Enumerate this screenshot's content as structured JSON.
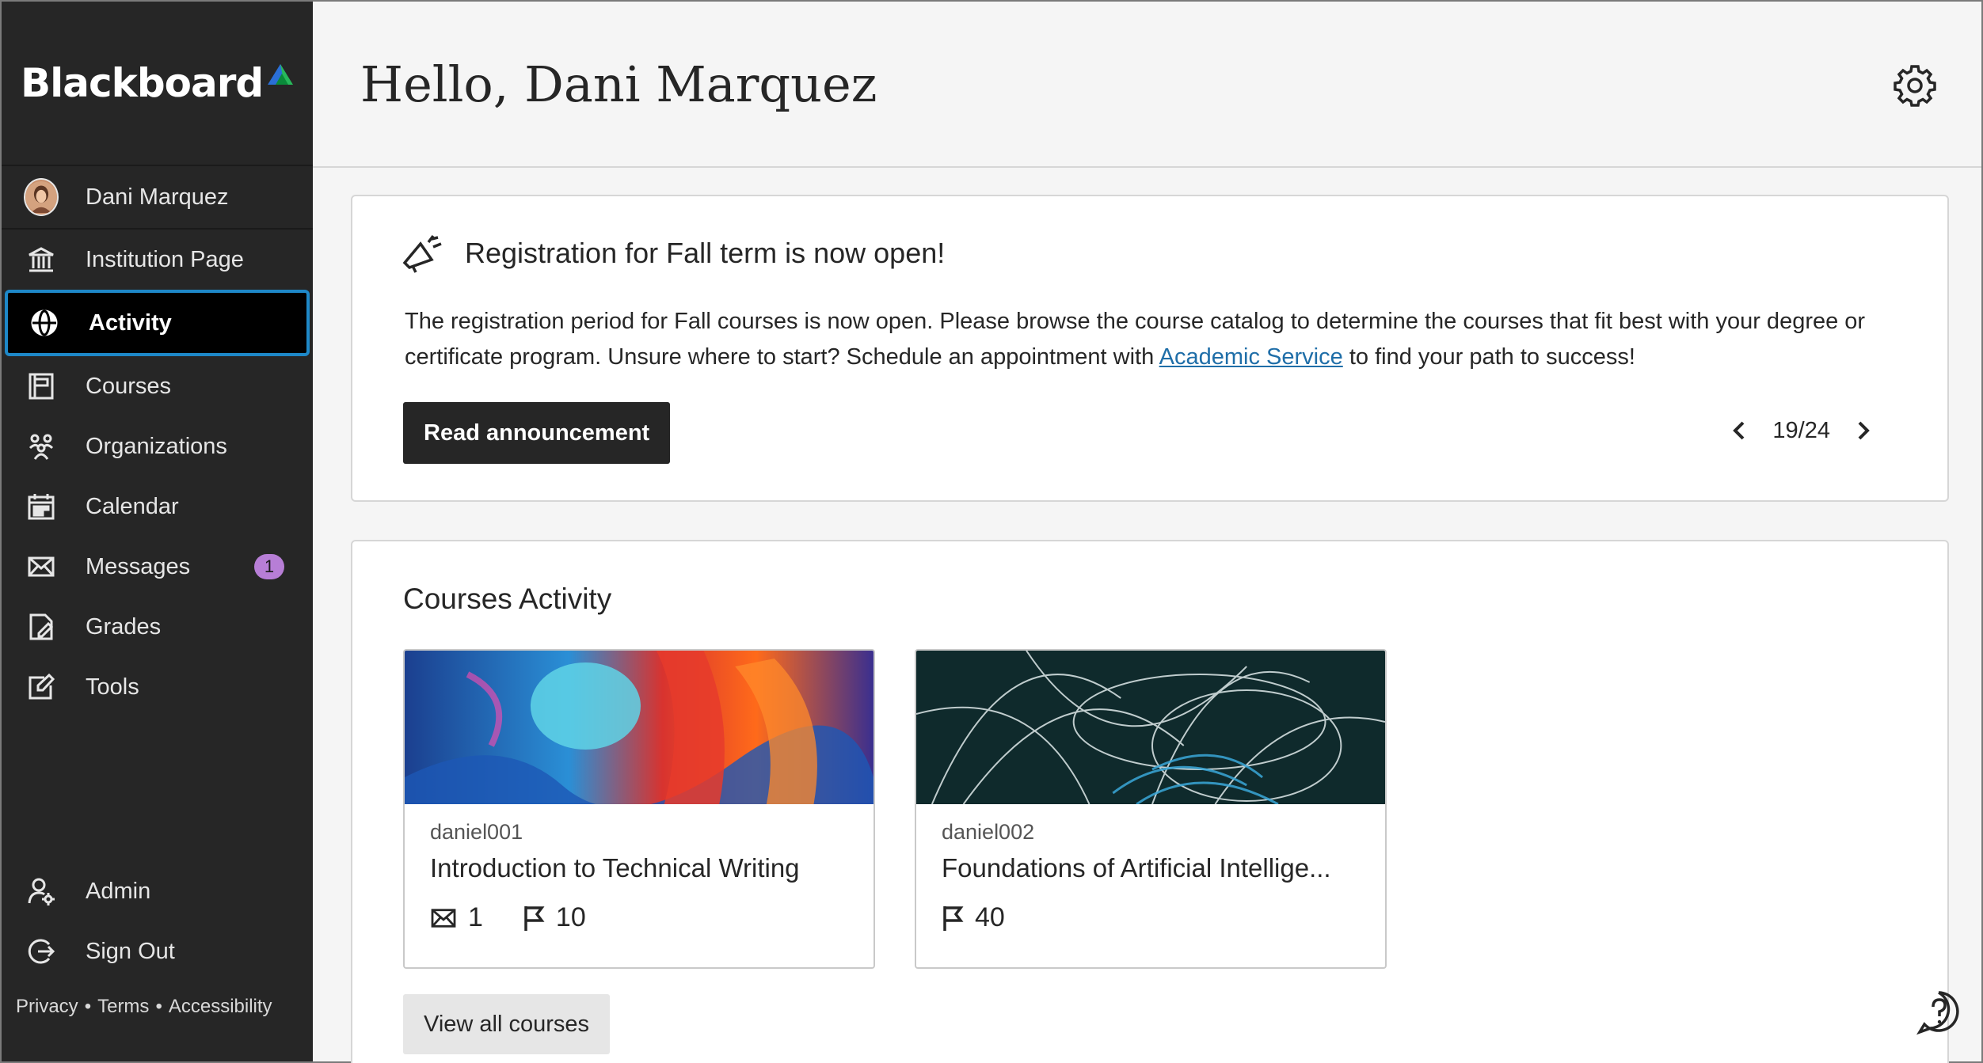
{
  "brand": {
    "name": "Blackboard"
  },
  "sidebar": {
    "user": "Dani Marquez",
    "items": [
      {
        "label": "Institution Page",
        "icon": "institution-icon"
      },
      {
        "label": "Activity",
        "icon": "globe-icon",
        "active": true
      },
      {
        "label": "Courses",
        "icon": "courses-icon"
      },
      {
        "label": "Organizations",
        "icon": "organizations-icon"
      },
      {
        "label": "Calendar",
        "icon": "calendar-icon"
      },
      {
        "label": "Messages",
        "icon": "envelope-icon",
        "badge": "1"
      },
      {
        "label": "Grades",
        "icon": "grades-icon"
      },
      {
        "label": "Tools",
        "icon": "tools-icon"
      }
    ],
    "bottom": [
      {
        "label": "Admin",
        "icon": "admin-icon"
      },
      {
        "label": "Sign Out",
        "icon": "sign-out-icon"
      }
    ],
    "legal": {
      "privacy": "Privacy",
      "terms": "Terms",
      "accessibility": "Accessibility",
      "separator": "•"
    }
  },
  "header": {
    "greeting": "Hello, Dani Marquez"
  },
  "announcement": {
    "title": "Registration for Fall term is now open!",
    "body_before": "The registration period for Fall courses is now open. Please browse the course catalog to determine the courses that fit best with your degree or certificate program. Unsure where to start? Schedule an appointment with ",
    "link": "Academic Service",
    "body_after": " to find your path to success!",
    "button": "Read announcement",
    "pager": "19/24"
  },
  "courses": {
    "title": "Courses Activity",
    "items": [
      {
        "code": "daniel001",
        "name": "Introduction to Technical Writing",
        "messages": "1",
        "flags": "10"
      },
      {
        "code": "daniel002",
        "name": "Foundations of Artificial Intellige...",
        "flags": "40"
      }
    ],
    "view_all": "View all courses"
  },
  "colors": {
    "sidebar": "#262626",
    "active_border": "#1e88c8",
    "link": "#1f6ea8",
    "badge": "#b77ed6"
  }
}
